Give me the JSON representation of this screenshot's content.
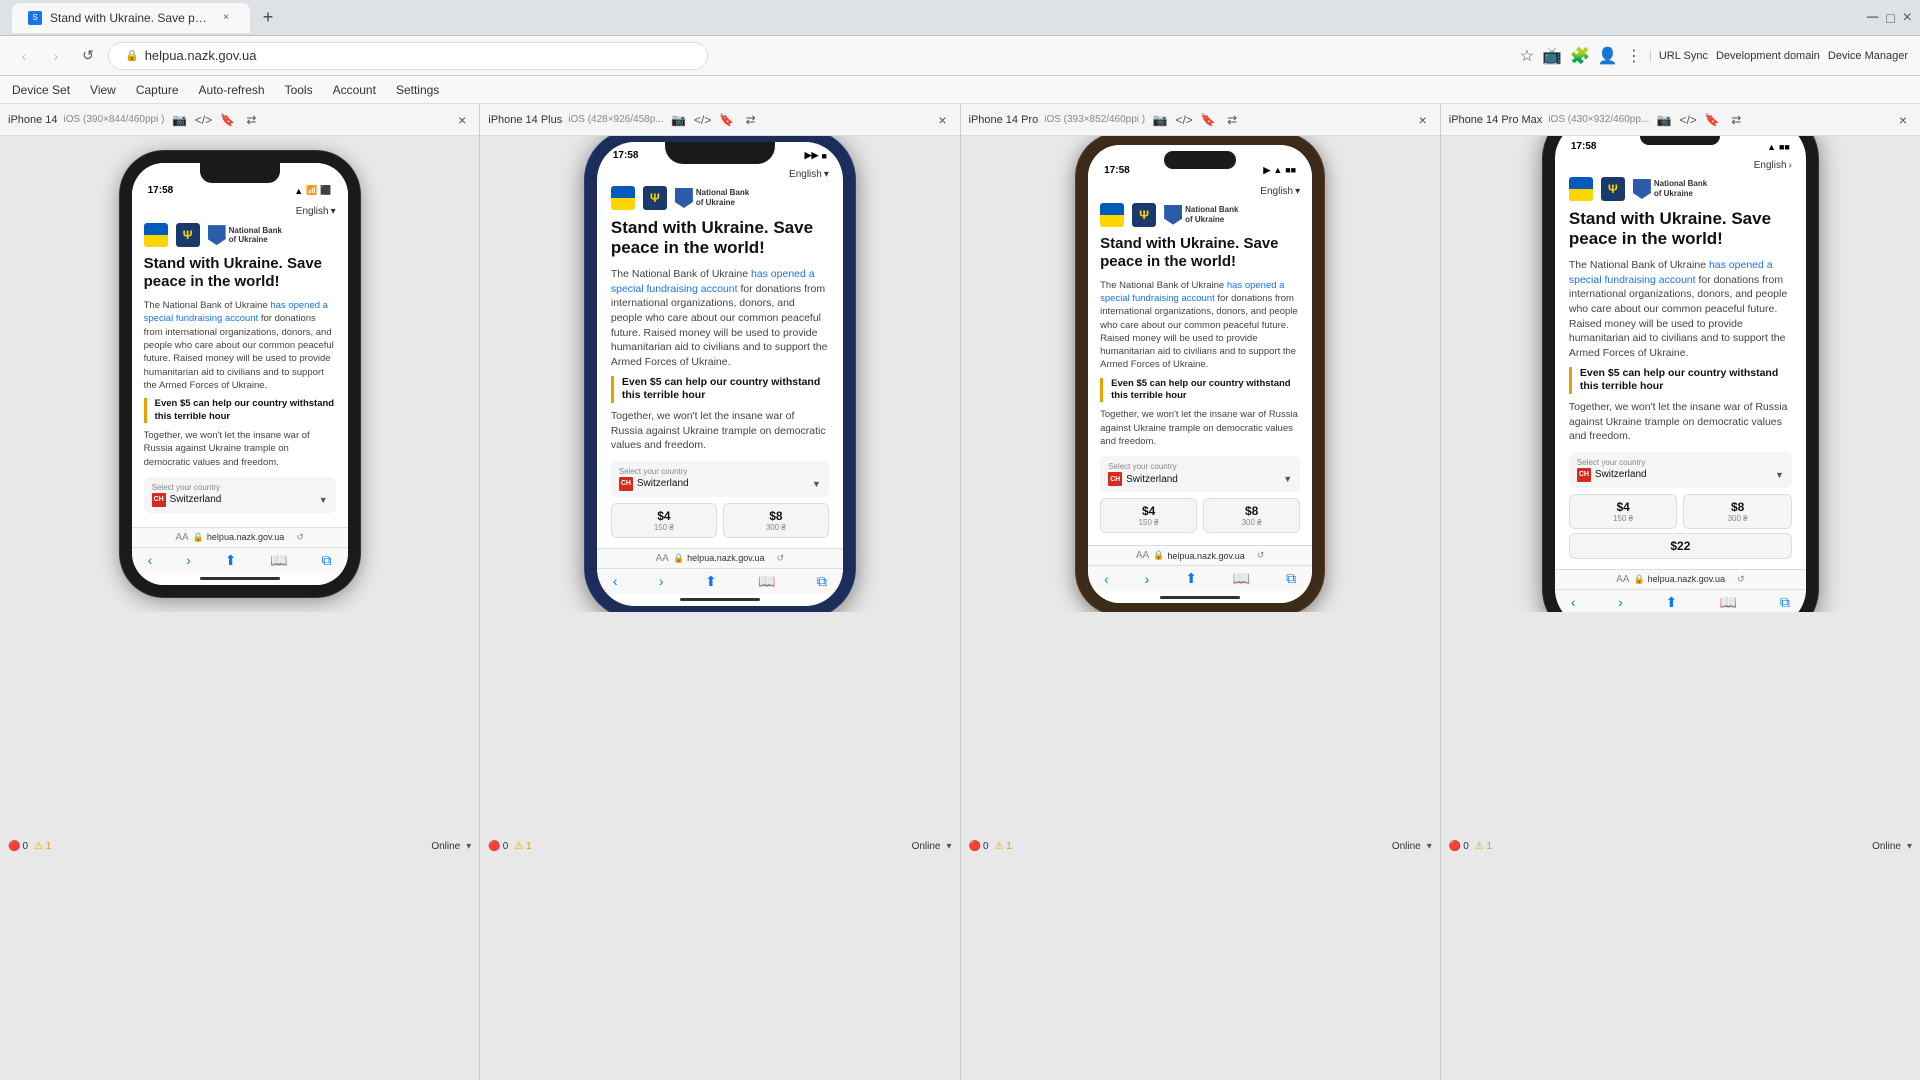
{
  "browser": {
    "tab_title": "Stand with Ukraine. Save peace i...",
    "tab_close": "×",
    "new_tab": "+",
    "nav_back": "‹",
    "nav_forward": "›",
    "nav_refresh": "↺",
    "url": "helpua.nazk.gov.ua",
    "url_icon": "🔒",
    "bookmark_icon": "☆",
    "extensions": "🧩",
    "address_right": [
      "URL Sync",
      "Development domain",
      "Device Manager"
    ],
    "menu_items": [
      "Device Set",
      "View",
      "Capture",
      "Auto-refresh",
      "Tools",
      "Account",
      "Settings"
    ]
  },
  "devices": [
    {
      "id": "iphone14",
      "name": "iPhone 14",
      "specs": "iOS (390×844/460ppi )",
      "type": "iphone14",
      "time": "17:58",
      "lang": "English",
      "lang_arrow": "▾"
    },
    {
      "id": "iphone14plus",
      "name": "iPhone 14 Plus",
      "specs": "iOS (428×926/458p...",
      "type": "iphone14plus",
      "time": "17:58",
      "lang": "English",
      "lang_arrow": "▾"
    },
    {
      "id": "iphone14pro",
      "name": "iPhone 14 Pro",
      "specs": "iOS (393×852/460ppi )",
      "type": "iphone14pro",
      "time": "17:58",
      "lang": "English",
      "lang_arrow": "▾"
    },
    {
      "id": "iphone14promax",
      "name": "iPhone 14 Pro Max",
      "specs": "iOS (430×932/460pp...",
      "type": "iphone14promax",
      "time": "17:58",
      "lang": "English",
      "lang_arrow": "›"
    }
  ],
  "content": {
    "title": "Stand with Ukraine. Save peace in the world!",
    "body1_prefix": "The National Bank of Ukraine ",
    "body1_link": "has opened a special fundraising account",
    "body1_suffix": " for donations from international organizations, donors, and people who care about our common peaceful future. Raised money will be used to provide humanitarian aid to civilians and to support the Armed Forces of Ukraine.",
    "quote": "Even $5 can help our country withstand this terrible hour",
    "together": "Together, we won't let the insane war of Russia against Ukraine trample on democratic values and freedom.",
    "country_label": "Select your country",
    "country_value": "Switzerland",
    "country_prefix": "CH",
    "donation1_amount": "$4",
    "donation1_sub": "150 ₴",
    "donation2_amount": "$8",
    "donation2_sub": "300 ₴",
    "donation3_amount": "$22",
    "url_display": "helpua.nazk.gov.ua"
  },
  "status": {
    "errors": "0",
    "warnings": "1",
    "online": "Online"
  }
}
